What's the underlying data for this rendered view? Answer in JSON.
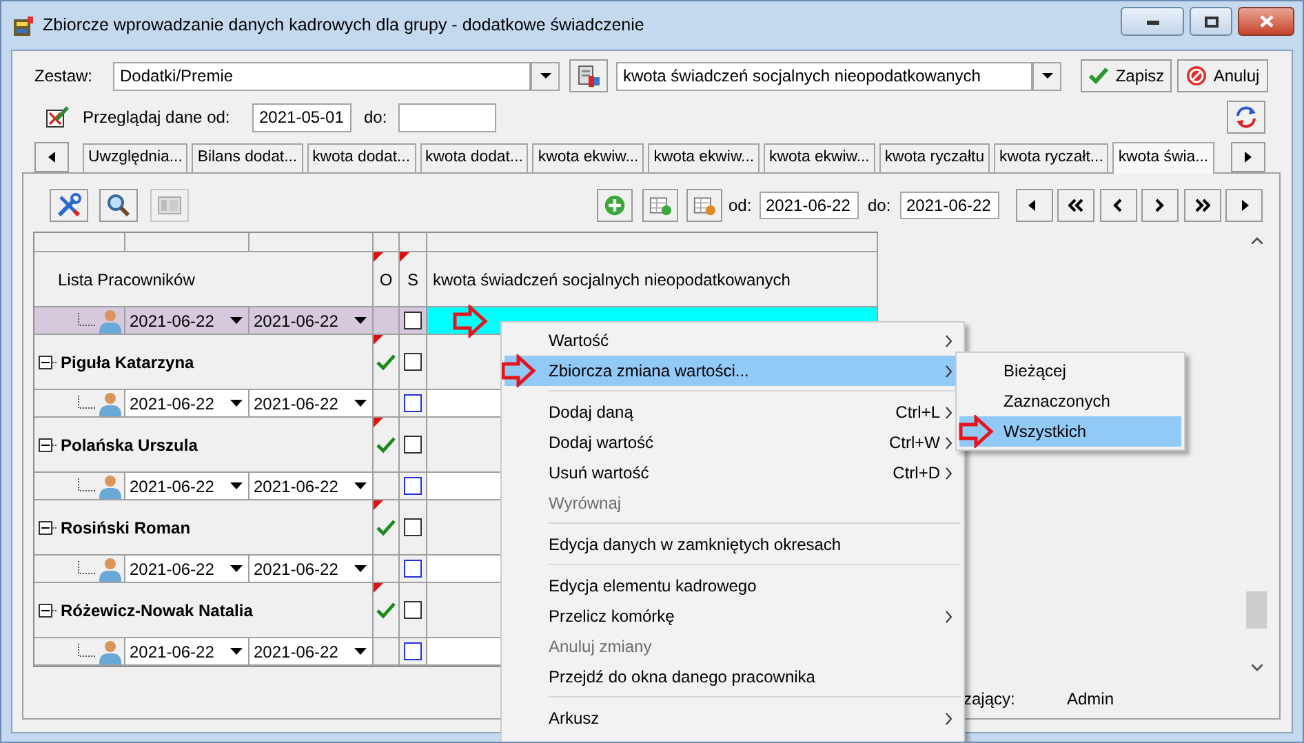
{
  "window": {
    "title": "Zbiorcze wprowadzanie danych kadrowych dla grupy  - dodatkowe świadczenie"
  },
  "set": {
    "label": "Zestaw:",
    "value": "Dodatki/Premie"
  },
  "element": {
    "value": "kwota świadczeń socjalnych nieopodatkowanych"
  },
  "buttons": [
    {
      "label": "Zapisz",
      "kind": "save"
    },
    {
      "label": "Anuluj",
      "kind": "cancel"
    }
  ],
  "filter": {
    "label": "Przeglądaj dane od:",
    "from": "2021-05-01",
    "to_label": "do:"
  },
  "tabs": [
    {
      "label": "Uwzględnia...",
      "selected": false
    },
    {
      "label": "Bilans dodat...",
      "selected": false
    },
    {
      "label": "kwota dodat...",
      "selected": false
    },
    {
      "label": "kwota dodat...",
      "selected": false
    },
    {
      "label": "kwota ekwiw...",
      "selected": false
    },
    {
      "label": "kwota ekwiw...",
      "selected": false
    },
    {
      "label": "kwota ekwiw...",
      "selected": false
    },
    {
      "label": "kwota ryczałtu",
      "selected": false
    },
    {
      "label": "kwota ryczałt...",
      "selected": false
    },
    {
      "label": "kwota świa...",
      "selected": true
    }
  ],
  "toolbar": {
    "from_label": "od:",
    "from": "2021-06-22",
    "to_label": "do:",
    "to": "2021-06-22"
  },
  "grid": {
    "columns": [
      {
        "label": "Lista Pracowników",
        "flagged": false
      },
      {
        "label": "O",
        "flagged": true
      },
      {
        "label": "S",
        "flagged": true
      },
      {
        "label": "kwota świadczeń socjalnych nieopodatkowanych",
        "flagged": false
      }
    ],
    "rows": [
      {
        "kind": "period",
        "from": "2021-06-22",
        "to": "2021-06-22",
        "selected": true,
        "checked": false
      },
      {
        "kind": "employee",
        "name": "Piguła Katarzyna",
        "expanded": true,
        "flagged": true,
        "confirmed": true,
        "checked": false
      },
      {
        "kind": "period",
        "from": "2021-06-22",
        "to": "2021-06-22",
        "selected": false,
        "checked": false
      },
      {
        "kind": "employee",
        "name": "Polańska Urszula",
        "expanded": true,
        "flagged": true,
        "confirmed": true,
        "checked": false
      },
      {
        "kind": "period",
        "from": "2021-06-22",
        "to": "2021-06-22",
        "selected": false,
        "checked": false
      },
      {
        "kind": "employee",
        "name": "Rosiński Roman",
        "expanded": true,
        "flagged": true,
        "confirmed": true,
        "checked": false
      },
      {
        "kind": "period",
        "from": "2021-06-22",
        "to": "2021-06-22",
        "selected": false,
        "checked": false
      },
      {
        "kind": "employee",
        "name": "Różewicz-Nowak Natalia",
        "expanded": true,
        "flagged": true,
        "confirmed": true,
        "checked": false
      },
      {
        "kind": "period",
        "from": "2021-06-22",
        "to": "2021-06-22",
        "selected": false,
        "checked": false
      }
    ]
  },
  "status": {
    "label": "zający:",
    "value": "Admin"
  },
  "context_menu": {
    "items": [
      {
        "kind": "item",
        "label": "Wartość",
        "submenu": true,
        "selected": false,
        "disabled": false
      },
      {
        "kind": "item",
        "label": "Zbiorcza zmiana wartości...",
        "submenu": true,
        "selected": true,
        "disabled": false
      },
      {
        "kind": "separator"
      },
      {
        "kind": "item",
        "label": "Dodaj daną",
        "shortcut": "Ctrl+L",
        "submenu": true,
        "selected": false,
        "disabled": false
      },
      {
        "kind": "item",
        "label": "Dodaj wartość",
        "shortcut": "Ctrl+W",
        "submenu": true,
        "selected": false,
        "disabled": false
      },
      {
        "kind": "item",
        "label": "Usuń wartość",
        "shortcut": "Ctrl+D",
        "submenu": true,
        "selected": false,
        "disabled": false
      },
      {
        "kind": "item",
        "label": "Wyrównaj",
        "submenu": false,
        "selected": false,
        "disabled": true
      },
      {
        "kind": "separator"
      },
      {
        "kind": "item",
        "label": "Edycja danych w zamkniętych okresach",
        "submenu": false,
        "selected": false,
        "disabled": false
      },
      {
        "kind": "separator"
      },
      {
        "kind": "item",
        "label": "Edycja elementu kadrowego",
        "submenu": false,
        "selected": false,
        "disabled": false
      },
      {
        "kind": "item",
        "label": "Przelicz komórkę",
        "submenu": true,
        "selected": false,
        "disabled": false
      },
      {
        "kind": "item",
        "label": "Anuluj zmiany",
        "submenu": false,
        "selected": false,
        "disabled": true
      },
      {
        "kind": "item",
        "label": "Przejdź do okna danego pracownika",
        "submenu": false,
        "selected": false,
        "disabled": false
      },
      {
        "kind": "separator"
      },
      {
        "kind": "item",
        "label": "Arkusz",
        "submenu": true,
        "selected": false,
        "disabled": false
      }
    ]
  },
  "submenu": {
    "items": [
      {
        "label": "Bieżącej",
        "selected": false
      },
      {
        "label": "Zaznaczonych",
        "selected": false
      },
      {
        "label": "Wszystkich",
        "selected": true
      }
    ]
  }
}
